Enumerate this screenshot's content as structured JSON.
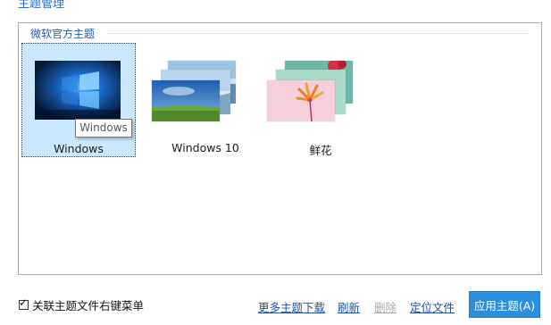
{
  "header": {
    "title": "主题管理"
  },
  "group": {
    "caption": "微软官方主题"
  },
  "themes": [
    {
      "label": "Windows",
      "selected": true,
      "tooltip": "Windows"
    },
    {
      "label": "Windows 10",
      "selected": false
    },
    {
      "label": "鲜花",
      "selected": false
    }
  ],
  "footer": {
    "checkbox_label": "关联主题文件右键菜单",
    "checkbox_checked": true,
    "links": {
      "more": "更多主题下载",
      "refresh": "刷新",
      "delete": "删除",
      "locate": "定位文件"
    },
    "apply_label": "应用主题(A)"
  },
  "colors": {
    "accent": "#2a8fdc",
    "selection": "#cce8ff",
    "link": "#1f4fa8",
    "disabled": "#a8a8a8"
  }
}
